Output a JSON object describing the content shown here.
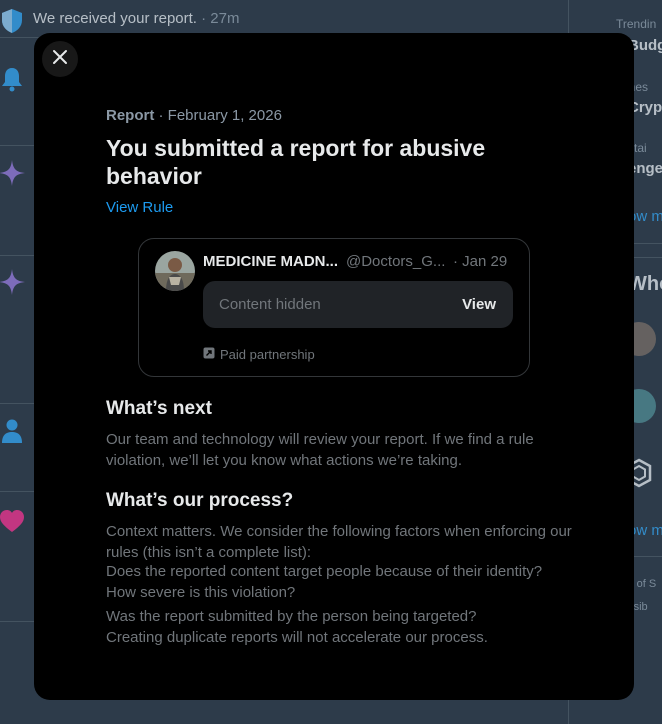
{
  "background": {
    "notification_text": "We received your report.",
    "notification_time": "· 27m",
    "right_col": {
      "trending_small": "Trendin",
      "item1_bold": "Budg",
      "business_small": "sines",
      "item2_bold": "Crypt",
      "entertain_small": "tertai",
      "item3_bold": "enge",
      "show_more_1": "ow m",
      "who_heading": "Who",
      "show_more_2": "ow m",
      "terms_small": "ns of S",
      "access_small": "essib"
    }
  },
  "modal": {
    "close_label": "Close",
    "meta_label": "Report",
    "meta_date": "· February 1, 2026",
    "title": "You submitted a report for abusive behavior",
    "view_rule": "View Rule",
    "card": {
      "name": "MEDICINE MADN...",
      "handle": "@Doctors_G...",
      "date": "· Jan 29",
      "hidden_text": "Content hidden",
      "view_label": "View",
      "paid_label": "Paid partnership"
    },
    "whats_next_heading": "What’s next",
    "whats_next_body": "Our team and technology will review your report. If we find a rule violation, we’ll let you know what actions we’re taking.",
    "process_heading": "What’s our process?",
    "process_intro": "Context matters. We consider the following factors when enforcing our rules (this isn’t a complete list):",
    "process_items": [
      "Does the reported content target people because of their identity?",
      "How severe is this violation?",
      "Was the report submitted by the person being targeted?",
      "Creating duplicate reports will not accelerate our process."
    ]
  },
  "colors": {
    "accent": "#1d9bf0",
    "page_bg": "#15202b",
    "modal_bg": "#000000",
    "muted": "#71767b"
  }
}
